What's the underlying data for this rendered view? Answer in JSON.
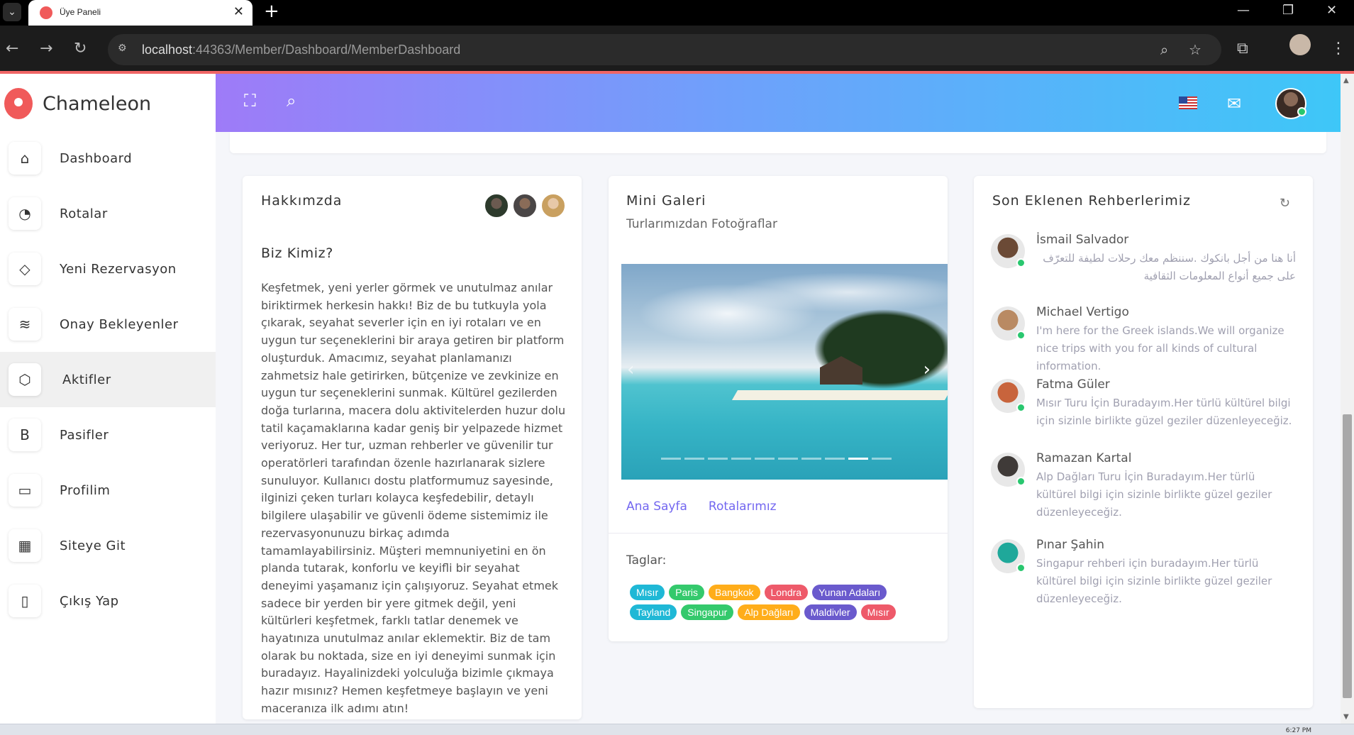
{
  "browser": {
    "tab_title": "Üye Paneli",
    "url_host": "localhost",
    "url_path": ":44363/Member/Dashboard/MemberDashboard"
  },
  "sidebar": {
    "brand": "Chameleon",
    "items": [
      {
        "label": "Dashboard",
        "icon": "home-icon"
      },
      {
        "label": "Rotalar",
        "icon": "pie-chart-icon"
      },
      {
        "label": "Yeni Rezervasyon",
        "icon": "droplet-icon"
      },
      {
        "label": "Onay Bekleyenler",
        "icon": "layers-icon"
      },
      {
        "label": "Aktifler",
        "icon": "box-icon",
        "active": true
      },
      {
        "label": "Pasifler",
        "icon": "bold-b-icon"
      },
      {
        "label": "Profilim",
        "icon": "credit-card-icon"
      },
      {
        "label": "Siteye Git",
        "icon": "layout-icon"
      },
      {
        "label": "Çıkış Yap",
        "icon": "book-icon"
      }
    ]
  },
  "about": {
    "title": "Hakkımzda",
    "subtitle": "Biz Kimiz?",
    "text": "Keşfetmek, yeni yerler görmek ve unutulmaz anılar biriktirmek herkesin hakkı! Biz de bu tutkuyla yola çıkarak, seyahat severler için en iyi rotaları ve en uygun tur seçeneklerini bir araya getiren bir platform oluşturduk. Amacımız, seyahat planlamanızı zahmetsiz hale getirirken, bütçenize ve zevkinize en uygun tur seçeneklerini sunmak. Kültürel gezilerden doğa turlarına, macera dolu aktivitelerden huzur dolu tatil kaçamaklarına kadar geniş bir yelpazede hizmet veriyoruz. Her tur, uzman rehberler ve güvenilir tur operatörleri tarafından özenle hazırlanarak sizlere sunuluyor. Kullanıcı dostu platformumuz sayesinde, ilginizi çeken turları kolayca keşfedebilir, detaylı bilgilere ulaşabilir ve güvenli ödeme sistemimiz ile rezervasyonunuzu birkaç adımda tamamlayabilirsiniz. Müşteri memnuniyetini en ön planda tutarak, konforlu ve keyifli bir seyahat deneyimi yaşamanız için çalışıyoruz. Seyahat etmek sadece bir yerden bir yere gitmek değil, yeni kültürleri keşfetmek, farklı tatlar denemek ve hayatınıza unutulmaz anılar eklemektir. Biz de tam olarak bu noktada, size en iyi deneyimi sunmak için buradayız. Hayalinizdeki yolculuğa bizimle çıkmaya hazır mısınız? Hemen keşfetmeye başlayın ve yeni maceranıza ilk adımı atın!"
  },
  "gallery": {
    "title": "Mini Galeri",
    "subtitle": "Turlarımızdan Fotoğraflar",
    "slide_count": 10,
    "active_slide": 8,
    "links": [
      "Ana Sayfa",
      "Rotalarımız"
    ],
    "tags_label": "Taglar:",
    "tags": [
      {
        "label": "Mısır",
        "color": "#1fb8d6"
      },
      {
        "label": "Paris",
        "color": "#34c96c"
      },
      {
        "label": "Bangkok",
        "color": "#ffad1a"
      },
      {
        "label": "Londra",
        "color": "#ee5a6a"
      },
      {
        "label": "Yunan Adaları",
        "color": "#6a5acd"
      },
      {
        "label": "Tayland",
        "color": "#1fb8d6"
      },
      {
        "label": "Singapur",
        "color": "#34c96c"
      },
      {
        "label": "Alp Dağları",
        "color": "#ffad1a"
      },
      {
        "label": "Maldivler",
        "color": "#6a5acd"
      },
      {
        "label": "Mısır",
        "color": "#ee5a6a"
      }
    ]
  },
  "guides": {
    "title": "Son Eklenen Rehberlerimiz",
    "items": [
      {
        "name": "İsmail Salvador",
        "desc": "أنا هنا من أجل بانكوك .سننظم معك رحلات لطيفة للتعرّف على جميع أنواع المعلومات الثقافية",
        "rtl": true,
        "avatar_color": "#6b4a36"
      },
      {
        "name": "Michael Vertigo",
        "desc": "I'm here for the Greek islands.We will organize nice trips with you for all kinds of cultural information.",
        "rtl": false,
        "avatar_color": "#b98a63"
      },
      {
        "name": "Fatma Güler",
        "desc": "Mısır Turu İçin Buradayım.Her türlü kültürel bilgi için sizinle birlikte güzel geziler düzenleyeceğiz.",
        "rtl": false,
        "avatar_color": "#c8643c"
      },
      {
        "name": "Ramazan Kartal",
        "desc": "Alp Dağları Turu İçin Buradayım.Her türlü kültürel bilgi için sizinle birlikte güzel geziler düzenleyeceğiz.",
        "rtl": false,
        "avatar_color": "#3f3a38"
      },
      {
        "name": "Pınar Şahin",
        "desc": "Singapur rehberi için buradayım.Her türlü kültürel bilgi için sizinle birlikte güzel geziler düzenleyeceğiz.",
        "rtl": false,
        "avatar_color": "#1fa89a"
      }
    ]
  },
  "taskbar": {
    "clock": "6:27 PM"
  }
}
